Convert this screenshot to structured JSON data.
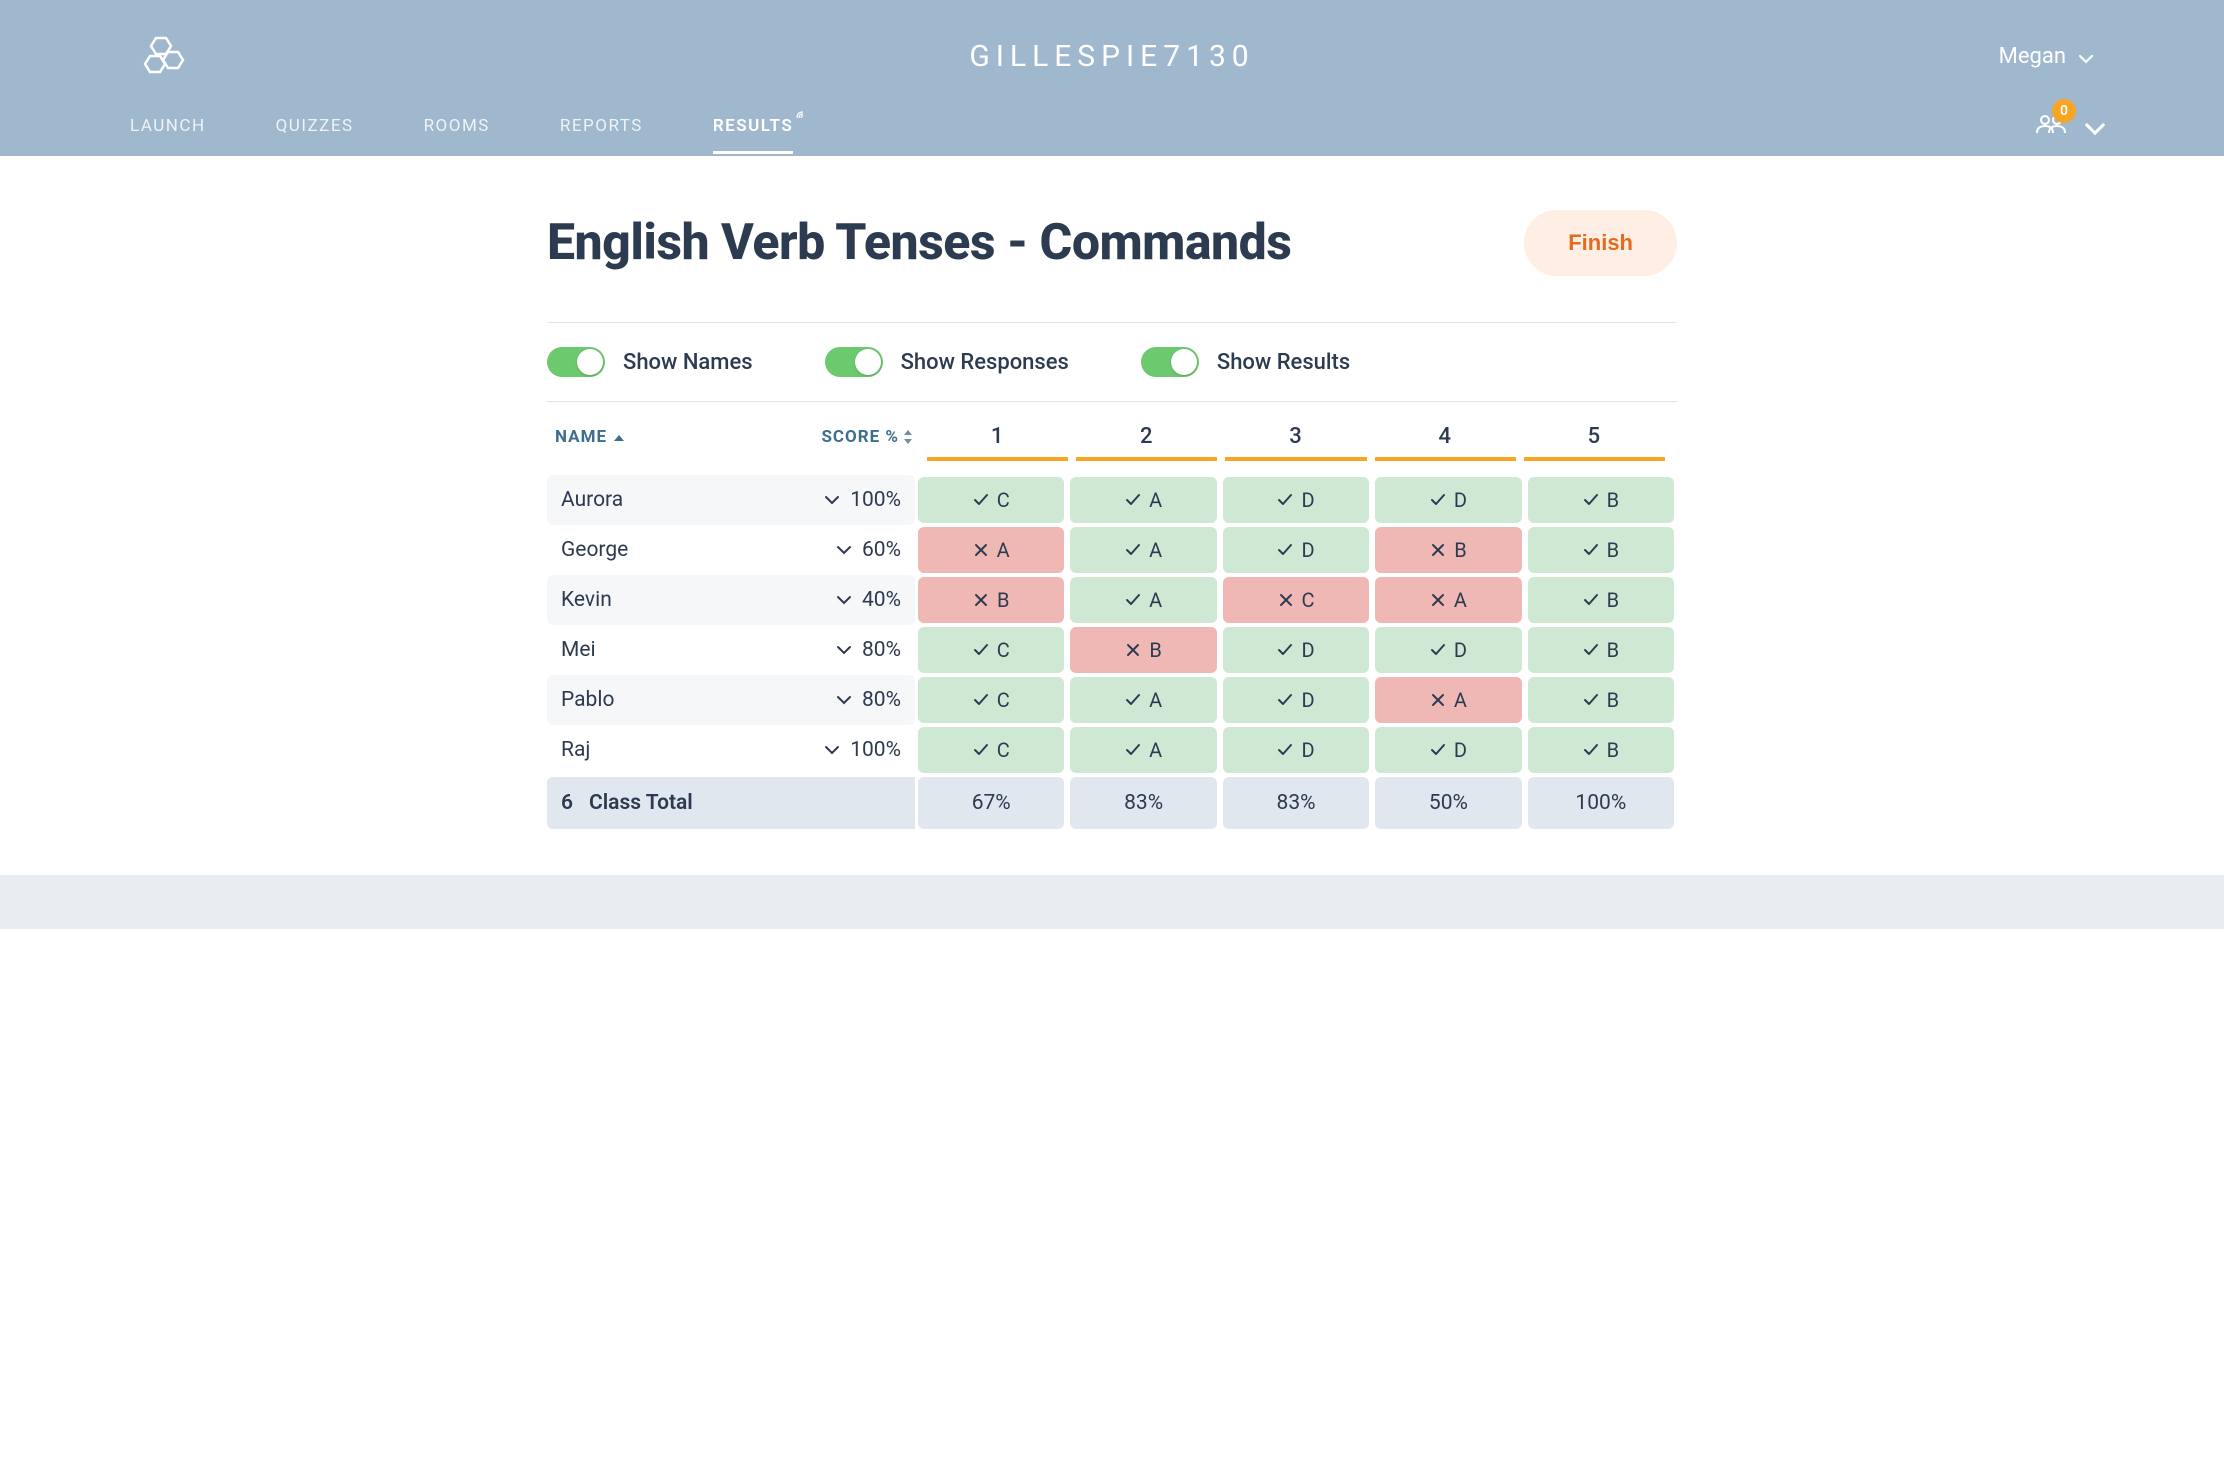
{
  "header": {
    "room_code": "GILLESPIE7130",
    "user_name": "Megan",
    "badge_count": "0"
  },
  "nav": {
    "items": [
      {
        "label": "LAUNCH"
      },
      {
        "label": "QUIZZES"
      },
      {
        "label": "ROOMS"
      },
      {
        "label": "REPORTS"
      },
      {
        "label": "RESULTS"
      }
    ],
    "active_index": 4
  },
  "page": {
    "title": "English Verb Tenses - Commands",
    "finish_label": "Finish"
  },
  "toggles": {
    "show_names": "Show Names",
    "show_responses": "Show Responses",
    "show_results": "Show Results"
  },
  "table": {
    "headers": {
      "name": "NAME",
      "score": "SCORE %",
      "questions": [
        "1",
        "2",
        "3",
        "4",
        "5"
      ]
    },
    "rows": [
      {
        "name": "Aurora",
        "score": "100%",
        "answers": [
          {
            "letter": "C",
            "correct": true
          },
          {
            "letter": "A",
            "correct": true
          },
          {
            "letter": "D",
            "correct": true
          },
          {
            "letter": "D",
            "correct": true
          },
          {
            "letter": "B",
            "correct": true
          }
        ]
      },
      {
        "name": "George",
        "score": "60%",
        "answers": [
          {
            "letter": "A",
            "correct": false
          },
          {
            "letter": "A",
            "correct": true
          },
          {
            "letter": "D",
            "correct": true
          },
          {
            "letter": "B",
            "correct": false
          },
          {
            "letter": "B",
            "correct": true
          }
        ]
      },
      {
        "name": "Kevin",
        "score": "40%",
        "answers": [
          {
            "letter": "B",
            "correct": false
          },
          {
            "letter": "A",
            "correct": true
          },
          {
            "letter": "C",
            "correct": false
          },
          {
            "letter": "A",
            "correct": false
          },
          {
            "letter": "B",
            "correct": true
          }
        ]
      },
      {
        "name": "Mei",
        "score": "80%",
        "answers": [
          {
            "letter": "C",
            "correct": true
          },
          {
            "letter": "B",
            "correct": false
          },
          {
            "letter": "D",
            "correct": true
          },
          {
            "letter": "D",
            "correct": true
          },
          {
            "letter": "B",
            "correct": true
          }
        ]
      },
      {
        "name": "Pablo",
        "score": "80%",
        "answers": [
          {
            "letter": "C",
            "correct": true
          },
          {
            "letter": "A",
            "correct": true
          },
          {
            "letter": "D",
            "correct": true
          },
          {
            "letter": "A",
            "correct": false
          },
          {
            "letter": "B",
            "correct": true
          }
        ]
      },
      {
        "name": "Raj",
        "score": "100%",
        "answers": [
          {
            "letter": "C",
            "correct": true
          },
          {
            "letter": "A",
            "correct": true
          },
          {
            "letter": "D",
            "correct": true
          },
          {
            "letter": "D",
            "correct": true
          },
          {
            "letter": "B",
            "correct": true
          }
        ]
      }
    ],
    "totals": {
      "count": "6",
      "label": "Class Total",
      "percents": [
        "67%",
        "83%",
        "83%",
        "50%",
        "100%"
      ]
    }
  },
  "colors": {
    "header_bg": "#a0b8ce",
    "correct_bg": "#cfe8d4",
    "wrong_bg": "#f0b8b5",
    "accent_orange": "#f5a623",
    "finish_text": "#e46a1f"
  }
}
